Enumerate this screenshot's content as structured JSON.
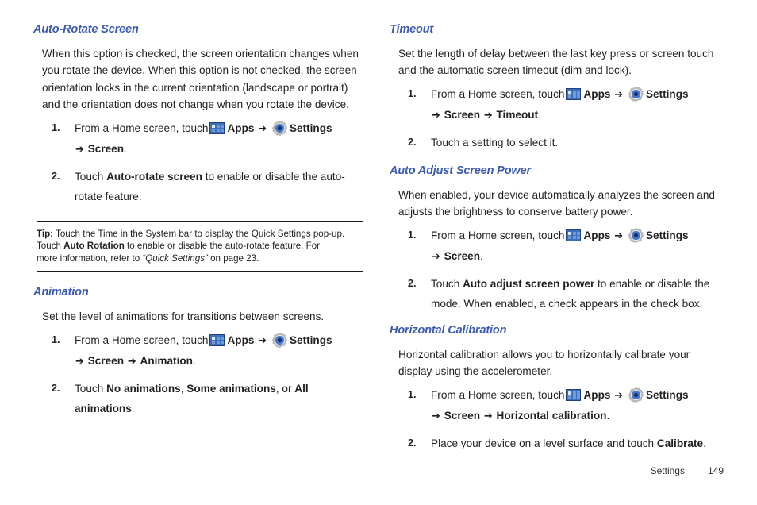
{
  "icons": {
    "apps": "apps-grid-icon",
    "settings": "gear-icon",
    "arrow": "➔"
  },
  "left_column": {
    "sections": [
      {
        "heading": "Auto-Rotate Screen",
        "intro": "When this option is checked, the screen orientation changes when you rotate the device. When this option is not checked, the screen orientation locks in the current orientation (landscape or portrait) and the orientation does not change when you rotate the device.",
        "steps": [
          {
            "num": "1.",
            "lead": "From a Home screen, touch",
            "apps_label": "Apps",
            "settings_label": "Settings",
            "path_tail": "Screen",
            "tail_period": "."
          },
          {
            "num": "2.",
            "pre": "Touch ",
            "bold": "Auto-rotate screen",
            "post": " to enable or disable the auto-rotate feature."
          }
        ]
      },
      {
        "heading": "Animation",
        "intro": "Set the level of animations for transitions between screens.",
        "steps": [
          {
            "num": "1.",
            "lead": "From a Home screen, touch",
            "apps_label": "Apps",
            "settings_label": "Settings",
            "path_tail": "Screen",
            "path_tail2": "Animation",
            "tail_period": "."
          },
          {
            "num": "2.",
            "pre": "Touch ",
            "bold": "No animations",
            "mid1": ", ",
            "bold2": "Some animations",
            "mid2": ", or ",
            "bold3": "All animations",
            "post": "."
          }
        ]
      }
    ],
    "tip": {
      "label": "Tip:",
      "line1": " Touch the Time in the System bar to display the Quick Settings pop-up.",
      "line2_pre": "Touch ",
      "line2_bold": "Auto Rotation",
      "line2_post": " to enable or disable the auto-rotate feature. For",
      "line3_pre": "more information, refer to ",
      "line3_italic": "“Quick Settings”",
      "line3_post": " on page 23."
    }
  },
  "right_column": {
    "sections": [
      {
        "heading": "Timeout",
        "intro": "Set the length of delay between the last key press or screen touch and the automatic screen timeout (dim and lock).",
        "steps": [
          {
            "num": "1.",
            "lead": "From a Home screen, touch",
            "apps_label": "Apps",
            "settings_label": "Settings",
            "path_tail": "Screen",
            "path_tail2": "Timeout",
            "tail_period": "."
          },
          {
            "num": "2.",
            "plain": "Touch a setting to select it."
          }
        ]
      },
      {
        "heading": "Auto Adjust Screen Power",
        "intro": "When enabled, your device automatically analyzes the screen and adjusts the brightness to conserve battery power.",
        "steps": [
          {
            "num": "1.",
            "lead": "From a Home screen, touch",
            "apps_label": "Apps",
            "settings_label": "Settings",
            "path_tail": "Screen",
            "tail_period": "."
          },
          {
            "num": "2.",
            "pre": "Touch ",
            "bold": "Auto adjust screen power",
            "post": " to enable or disable the mode. When enabled, a check appears in the check box."
          }
        ]
      },
      {
        "heading": "Horizontal Calibration",
        "intro": "Horizontal calibration allows you to horizontally calibrate your display using the accelerometer.",
        "steps": [
          {
            "num": "1.",
            "lead": "From a Home screen, touch",
            "apps_label": "Apps",
            "settings_label": "Settings",
            "path_tail": "Screen",
            "path_tail2": "Horizontal calibration",
            "tail_period": "."
          },
          {
            "num": "2.",
            "pre": "Place your device on a level surface and touch ",
            "bold": "Calibrate",
            "post": "."
          }
        ]
      }
    ]
  },
  "footer": {
    "label": "Settings",
    "page": "149"
  },
  "colors": {
    "heading_blue": "#3c5bb0",
    "body_text": "#231f20",
    "rule_black": "#1a1a1a",
    "apps_icon_blue": "#3d6fbf",
    "gear_blue": "#2d58a8"
  }
}
